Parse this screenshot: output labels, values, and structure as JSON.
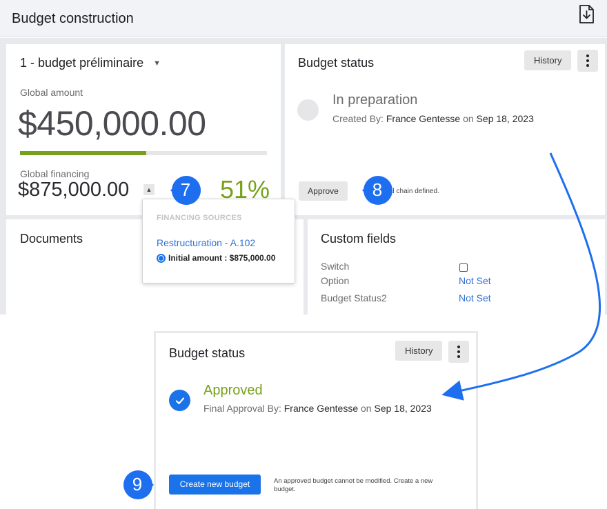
{
  "header": {
    "title": "Budget construction",
    "export_icon": "download-file-icon"
  },
  "summary": {
    "budget_name": "1 - budget préliminaire",
    "global_amount_label": "Global amount",
    "global_amount": "$450,000.00",
    "progress_fraction": 0.51,
    "global_financing_label": "Global financing",
    "global_financing": "$875,000.00",
    "financing_percent": "51%"
  },
  "financing_popover": {
    "heading": "FINANCING SOURCES",
    "source_link": "Restructuration - A.102",
    "initial_amount": "Initial amount : $875,000.00"
  },
  "status_before": {
    "title": "Budget status",
    "history_label": "History",
    "state": "In preparation",
    "created_by_prefix": "Created By:",
    "created_by": "France Gentesse",
    "on": "on",
    "date": "Sep 18, 2023",
    "approve_label": "Approve",
    "note_visible": "al chain defined."
  },
  "documents": {
    "title": "Documents"
  },
  "custom_fields": {
    "title": "Custom fields",
    "fields": [
      {
        "label": "Switch",
        "value": ""
      },
      {
        "label": "Option",
        "value": "Not Set"
      },
      {
        "label": "Budget Status2",
        "value": "Not Set"
      }
    ]
  },
  "status_after": {
    "title": "Budget status",
    "history_label": "History",
    "state": "Approved",
    "approval_prefix": "Final Approval By:",
    "approved_by": "France Gentesse",
    "on": "on",
    "date": "Sep 18, 2023",
    "create_label": "Create new budget",
    "note": "An approved budget cannot be modified. Create a new budget."
  },
  "callouts": [
    "7",
    "8",
    "9"
  ],
  "colors": {
    "accent_blue": "#1a73e8",
    "approved_green": "#77a11b",
    "callout_blue": "#1e6ff0"
  }
}
